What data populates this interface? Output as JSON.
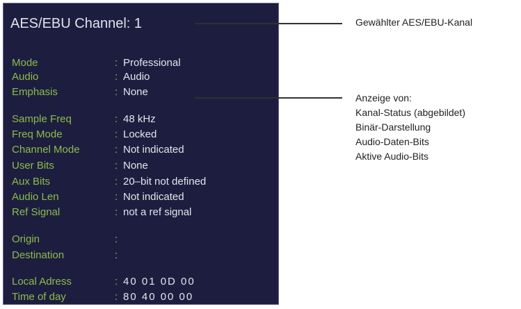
{
  "screen": {
    "title": "AES/EBU Channel: 1",
    "sep": ":",
    "rows": [
      {
        "label": "Mode",
        "value": "Professional"
      },
      {
        "label": "Audio",
        "value": "Audio"
      },
      {
        "label": "Emphasis",
        "value": "None"
      },
      {
        "label": "Sample Freq",
        "value": "48 kHz"
      },
      {
        "label": "Freq Mode",
        "value": "Locked"
      },
      {
        "label": "Channel Mode",
        "value": "Not indicated"
      },
      {
        "label": "User Bits",
        "value": "None"
      },
      {
        "label": "Aux Bits",
        "value": "20–bit not defined"
      },
      {
        "label": "Audio Len",
        "value": "Not indicated"
      },
      {
        "label": "Ref Signal",
        "value": "not a ref signal"
      },
      {
        "label": "Origin",
        "value": ""
      },
      {
        "label": "Destination",
        "value": ""
      },
      {
        "label": "Local Adress",
        "value": "40  01  0D  00"
      },
      {
        "label": "Time of day",
        "value": "80  40  00  00"
      }
    ]
  },
  "callouts": {
    "channel": "Gewählter AES/EBU-Kanal",
    "display_lines": [
      "Anzeige von:",
      "Kanal-Status (abgebildet)",
      "Binär-Darstellung",
      "Audio-Daten-Bits",
      "Aktive Audio-Bits"
    ]
  },
  "colors": {
    "screen_bg": "#1d1e3f",
    "label_green": "#8cbc4a",
    "value_white": "#e4e4ec"
  }
}
